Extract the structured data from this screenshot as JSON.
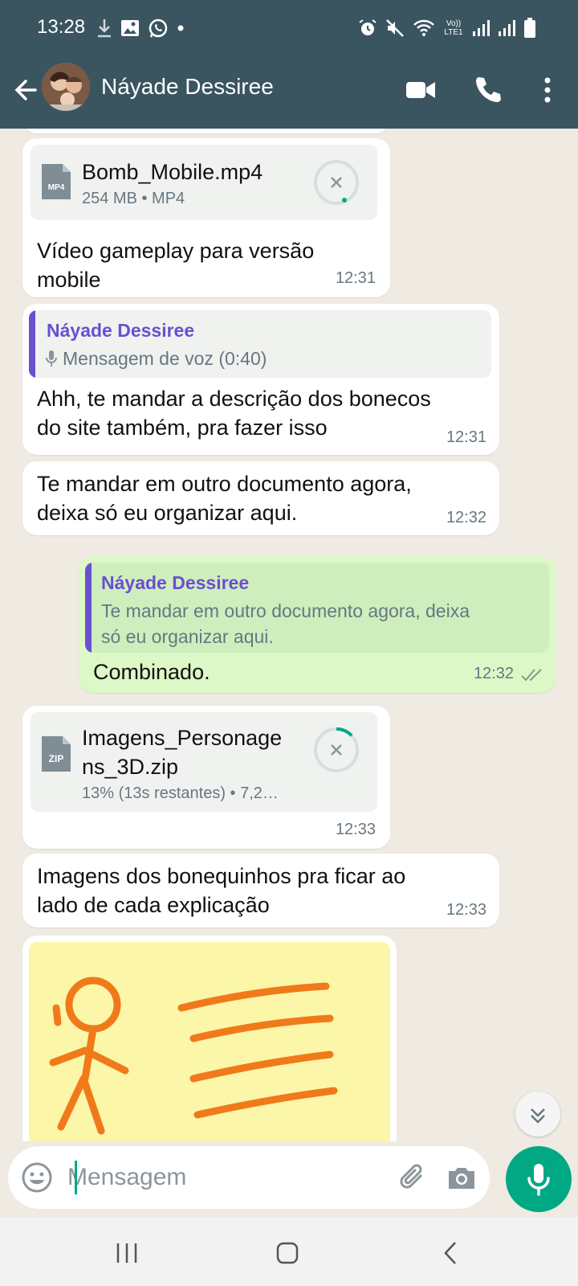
{
  "status_bar": {
    "time": "13:28",
    "left_icons": [
      "download-icon",
      "image-icon",
      "whatsapp-icon",
      "dot-icon"
    ],
    "right_icons": [
      "alarm-icon",
      "mute-icon",
      "wifi-icon",
      "volte-icon",
      "signal-icon",
      "signal-icon",
      "battery-icon"
    ],
    "volte_label": "Vo)) LTE1"
  },
  "header": {
    "contact_name": "Náyade Dessiree",
    "icons": [
      "back-arrow-icon",
      "video-call-icon",
      "voice-call-icon",
      "more-options-icon"
    ]
  },
  "messages": [
    {
      "type": "file",
      "file_name": "Bomb_Mobile.mp4",
      "file_meta": "254 MB • MP4",
      "file_type_badge": "MP4",
      "caption_line1": "Vídeo gameplay para versão",
      "caption_line2": "mobile",
      "time": "12:31"
    },
    {
      "type": "reply",
      "quoted_name": "Náyade Dessiree",
      "quoted_text": "Mensagem de voz (0:40)",
      "text_line1": "Ahh, te mandar a descrição dos bonecos",
      "text_line2": "do site também, pra fazer isso",
      "time": "12:31"
    },
    {
      "type": "text",
      "text_line1": "Te mandar em outro documento agora,",
      "text_line2": "deixa só eu organizar aqui.",
      "time": "12:32"
    },
    {
      "type": "reply_outgoing",
      "quoted_name": "Náyade Dessiree",
      "quoted_text_line1": "Te mandar em outro documento agora, deixa",
      "quoted_text_line2": "só eu organizar aqui.",
      "text": "Combinado.",
      "time": "12:32",
      "status": "read"
    },
    {
      "type": "file",
      "file_name_line1": "Imagens_Personage",
      "file_name_line2": "ns_3D.zip",
      "file_meta": "13% (13s restantes) • 7,2…",
      "file_type_badge": "ZIP",
      "progress": 0.13,
      "time": "12:33"
    },
    {
      "type": "text",
      "text_line1": "Imagens dos bonequinhos pra ficar ao",
      "text_line2": "lado de cada explicação",
      "time": "12:33"
    },
    {
      "type": "image",
      "description": "stick figure drawing on yellow background"
    }
  ],
  "input": {
    "placeholder": "Mensagem"
  },
  "colors": {
    "header": "#3a5560",
    "accent": "#00a884",
    "outgoing_bubble": "#dcf8c6",
    "quote_name": "#6a4fd1",
    "chat_bg": "#efeae2"
  }
}
